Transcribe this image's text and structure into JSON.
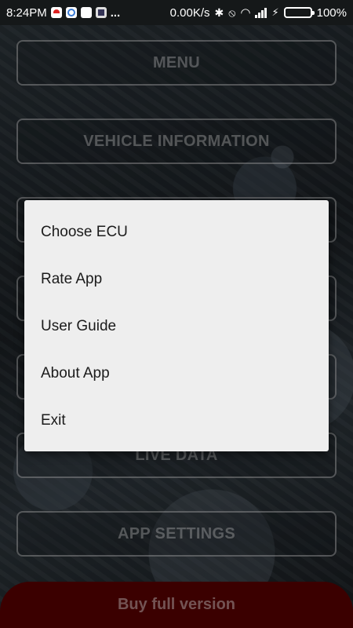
{
  "status_bar": {
    "time": "8:24PM",
    "more": "...",
    "speed": "0.00K/s",
    "battery_percent": "100%",
    "battery_level": 1.0,
    "icons": [
      "notification-red-icon",
      "alarm-clock-icon",
      "wifi-notification-icon",
      "app-notification-icon",
      "bluetooth-icon",
      "vibrate-off-icon",
      "wifi-icon",
      "cell-signal-icon",
      "charging-icon",
      "battery-icon"
    ]
  },
  "main_buttons": {
    "menu": "MENU",
    "vehicle_information": "VEHICLE INFORMATION",
    "live_data": "LIVE DATA",
    "app_settings": "APP SETTINGS"
  },
  "buy_bar": {
    "label": "Buy full version",
    "color": "#520000"
  },
  "popup_menu": {
    "items": [
      {
        "label": "Choose ECU"
      },
      {
        "label": "Rate App"
      },
      {
        "label": "User Guide"
      },
      {
        "label": "About App"
      },
      {
        "label": "Exit"
      }
    ]
  }
}
